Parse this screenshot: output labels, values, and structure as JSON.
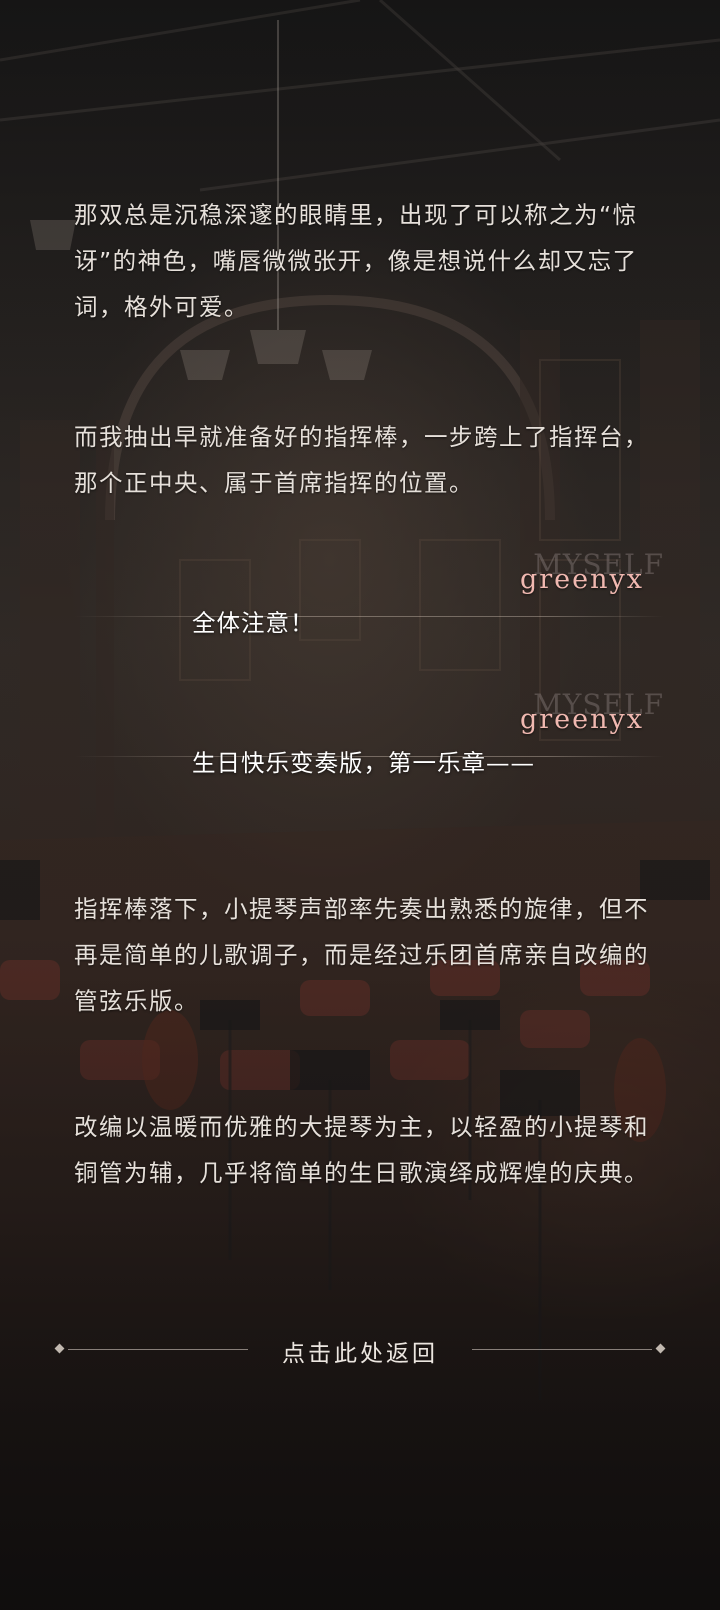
{
  "story": {
    "paragraphs": [
      "那双总是沉稳深邃的眼睛里，出现了可以称之为“惊讶”的神色，嘴唇微微张开，像是想说什么却又忘了词，格外可爱。",
      "而我抽出早就准备好的指挥棒，一步跨上了指挥台，那个正中央、属于首席指挥的位置。",
      "指挥棒落下，小提琴声部率先奏出熟悉的旋律，但不再是简单的儿歌调子，而是经过乐团首席亲自改编的管弦乐版。",
      "改编以温暖而优雅的大提琴为主，以轻盈的小提琴和铜管为辅，几乎将简单的生日歌演绎成辉煌的庆典。"
    ],
    "dialogs": [
      {
        "speaker_bg": "MYSELF",
        "speaker": "greenyx",
        "text": "全体注意！"
      },
      {
        "speaker_bg": "MYSELF",
        "speaker": "greenyx",
        "text": "生日快乐变奏版，第一乐章——"
      }
    ]
  },
  "footer": {
    "return_label": "点击此处返回"
  }
}
